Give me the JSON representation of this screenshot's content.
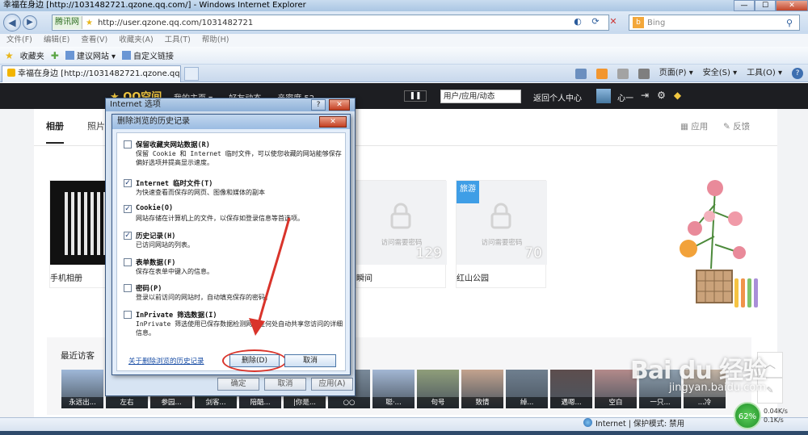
{
  "window": {
    "title": "幸福在身边 [http://1031482721.qzone.qq.com/] - Windows Internet Explorer",
    "min_label": "—",
    "max_label": "☐",
    "close_label": "✕"
  },
  "address": {
    "site_badge": "腾讯网",
    "url": "http://user.qzone.qq.com/1031482721",
    "search_engine": "Bing",
    "search_placeholder": "Bing"
  },
  "menu": [
    "文件(F)",
    "编辑(E)",
    "查看(V)",
    "收藏夹(A)",
    "工具(T)",
    "帮助(H)"
  ],
  "favorites": {
    "favorites_label": "收藏夹",
    "suggested_sites": "建议网站 ▾",
    "custom_link": "自定义链接"
  },
  "tab": {
    "title": "幸福在身边 [http://1031482721.qzone.qq.com..."
  },
  "commandbar": {
    "page": "页面(P) ▾",
    "safety": "安全(S) ▾",
    "tools": "工具(O) ▾",
    "help_icon": "?"
  },
  "qzone": {
    "logo": "QQ空间",
    "nav": [
      "我的主页 ▾",
      "好友动态",
      "亲密度 52"
    ],
    "pause_label": "❚❚",
    "search_placeholder": "用户/应用/动态",
    "back_label": "返回个人中心",
    "user_name": "心一",
    "tabs": [
      "相册",
      "照片"
    ],
    "apps_label": "应用",
    "feedback_label": "反馈",
    "lock_text": "访问需要密码",
    "albums": [
      {
        "name": "手机相册",
        "count": ""
      },
      {
        "name": "瞬间",
        "count": "129"
      },
      {
        "name": "红山公园",
        "count": "70",
        "ribbon": "旅游"
      }
    ],
    "visitors_title": "最近访客",
    "visitors": [
      "永远出...",
      "左右",
      "参园...",
      "剑客...",
      "陪酷...",
      "|你是...",
      "○○",
      "聪·...",
      "句号",
      "致情",
      "绰...",
      "遇嗯...",
      "空白",
      "一只...",
      "...冷"
    ],
    "scroll_top": "︿"
  },
  "watermark": {
    "main": "Bai du 经验",
    "sub": "jingyan.baidu.com"
  },
  "inet_dialog": {
    "title": "Internet 选项",
    "help_label": "?",
    "close_label": "✕",
    "buttons": [
      "确定",
      "取消",
      "应用(A)"
    ]
  },
  "delete_dialog": {
    "title": "删除浏览的历史记录",
    "close_label": "✕",
    "options": [
      {
        "checked": false,
        "title": "保留收藏夹网站数据(R)",
        "desc": "保留 Cookie 和 Internet 临时文件，可以使您收藏的网站能够保存偏好选项并提高显示速度。"
      },
      {
        "checked": true,
        "title": "Internet 临时文件(T)",
        "desc": "为快速查看而保存的网页、图像和媒体的副本"
      },
      {
        "checked": true,
        "title": "Cookie(O)",
        "desc": "网站存储在计算机上的文件，以保存如登录信息等首选项。"
      },
      {
        "checked": true,
        "title": "历史记录(H)",
        "desc": "已访问网站的列表。"
      },
      {
        "checked": false,
        "title": "表单数据(F)",
        "desc": "保存在表单中键入的信息。"
      },
      {
        "checked": false,
        "title": "密码(P)",
        "desc": "登录以前访问的网站时，自动填充保存的密码。"
      },
      {
        "checked": false,
        "title": "InPrivate 筛选数据(I)",
        "desc": "InPrivate 筛选使用已保存数据检测网站在何处自动共享您访问的详细信息。"
      }
    ],
    "about_link": "关于删除浏览的历史记录",
    "delete_label": "删除(D)",
    "cancel_label": "取消"
  },
  "status": {
    "zone": "Internet | 保护模式: 禁用",
    "net_percent": "62%",
    "up_speed": "0.04K/s",
    "down_speed": "0.1K/s"
  },
  "colors": {
    "qzone_bar": "#1d1e22",
    "accent_blue": "#3f9ee6",
    "highlight_red": "#d9342b"
  }
}
